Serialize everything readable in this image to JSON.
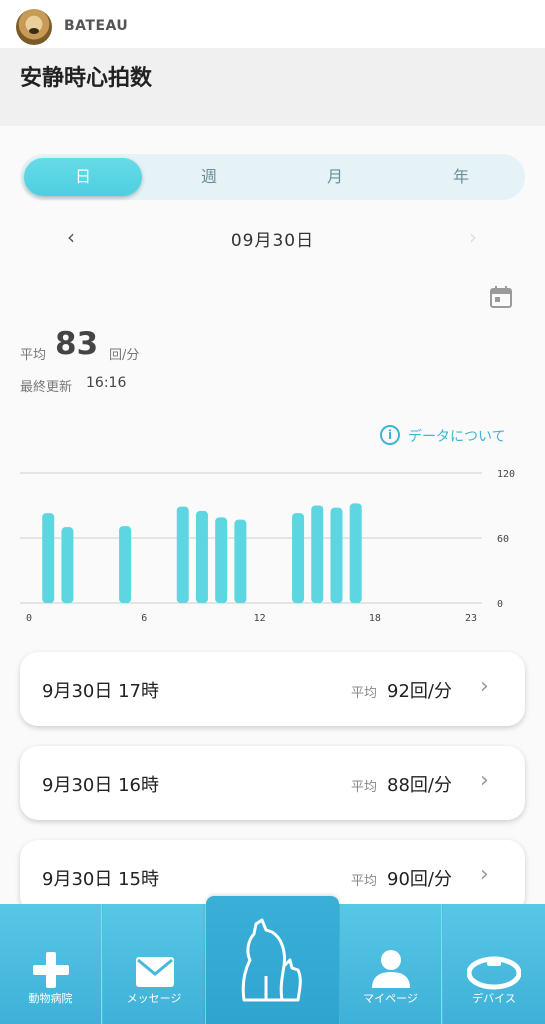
{
  "header": {
    "username": "BATEAU",
    "title": "安静時心拍数"
  },
  "tabs": [
    {
      "label": "日",
      "active": true
    },
    {
      "label": "週",
      "active": false
    },
    {
      "label": "月",
      "active": false
    },
    {
      "label": "年",
      "active": false
    }
  ],
  "date_nav": {
    "prev_icon": "chevron-left-icon",
    "date": "09月30日",
    "next_icon": "chevron-right-icon"
  },
  "summary": {
    "avg_label": "平均",
    "avg_value": "83",
    "avg_unit": "回/分",
    "updated_label": "最終更新",
    "updated_time": "16:16"
  },
  "data_info": {
    "icon": "info-icon",
    "label": "データについて"
  },
  "chart_data": {
    "type": "bar",
    "x_ticks": [
      "0",
      "6",
      "12",
      "18",
      "23"
    ],
    "y_ticks": [
      "120",
      "60",
      "0"
    ],
    "ylim": [
      0,
      120
    ],
    "xlim": [
      0,
      23
    ],
    "bar_color": "#5dd6e2",
    "bars": [
      {
        "hour": 1,
        "value": 83
      },
      {
        "hour": 2,
        "value": 70
      },
      {
        "hour": 5,
        "value": 71
      },
      {
        "hour": 8,
        "value": 89
      },
      {
        "hour": 9,
        "value": 85
      },
      {
        "hour": 10,
        "value": 79
      },
      {
        "hour": 11,
        "value": 77
      },
      {
        "hour": 14,
        "value": 83
      },
      {
        "hour": 15,
        "value": 90
      },
      {
        "hour": 16,
        "value": 88
      },
      {
        "hour": 17,
        "value": 92
      }
    ]
  },
  "records": [
    {
      "time": "9月30日 17時",
      "avg_label": "平均",
      "value": "92回/分"
    },
    {
      "time": "9月30日 16時",
      "avg_label": "平均",
      "value": "88回/分"
    },
    {
      "time": "9月30日 15時",
      "avg_label": "平均",
      "value": "90回/分"
    }
  ],
  "bottom_nav": [
    {
      "label": "動物病院",
      "icon": "plus-icon"
    },
    {
      "label": "メッセージ",
      "icon": "envelope-icon"
    },
    {
      "label": "",
      "icon": "pet-home-icon"
    },
    {
      "label": "マイページ",
      "icon": "person-icon"
    },
    {
      "label": "デバイス",
      "icon": "collar-icon"
    }
  ],
  "colors": {
    "accent": "#4ccfe0",
    "link": "#3fb4d4",
    "nav_bg": "#4bbfdf"
  }
}
